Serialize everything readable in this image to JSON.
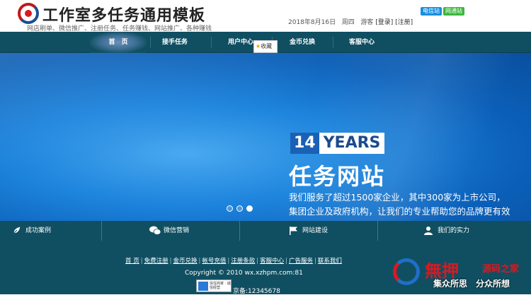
{
  "header": {
    "site_title": "工作室多任务通用模板",
    "slogan": "网店刷单、微信推广、注册任务、任务赚钱、网站推广、各种赚钱",
    "date": "2018年8月16日",
    "weekday": "周四",
    "guest": "游客",
    "login": "[登录]",
    "register": "[注册]",
    "mobile_label": "电信站",
    "mobile_color": "#1a8fe0",
    "netcom_label": "网通站",
    "netcom_color": "#3cb83c"
  },
  "nav": {
    "items": [
      "首　页",
      "接手任务",
      "用户中心",
      "金币兑换",
      "客服中心"
    ],
    "favorite_label": "收藏",
    "background_color": "#104f62"
  },
  "banner": {
    "years_number": "14",
    "years_text": "YEARS",
    "title": "任务网站",
    "desc_line1": "我们服务了超过1500家企业，其中300家为上市公司，",
    "desc_line2": "集团企业及政府机构，让我们的专业帮助您的品牌更有效",
    "active_slide": 3,
    "slide_count": 3
  },
  "features": [
    {
      "label": "成功案例",
      "icon": "leaf-icon"
    },
    {
      "label": "微信营销",
      "icon": "wechat-icon"
    },
    {
      "label": "网站建设",
      "icon": "flag-icon"
    },
    {
      "label": "我们的实力",
      "icon": "person-icon"
    }
  ],
  "footer": {
    "links": [
      "首 页",
      "免费注册",
      "金币兑换",
      "帐号充值",
      "注册条款",
      "客服中心",
      "广告服务",
      "联系我们"
    ],
    "copyright": "Copyright © 2010 wx.xzhpm.com:81",
    "badge_text": "信任商家 · 诚信经营",
    "icp": "京备:12345678"
  },
  "watermark": {
    "big": "無押",
    "name": "源码之家",
    "slogan": "集众所思　分众所想"
  }
}
